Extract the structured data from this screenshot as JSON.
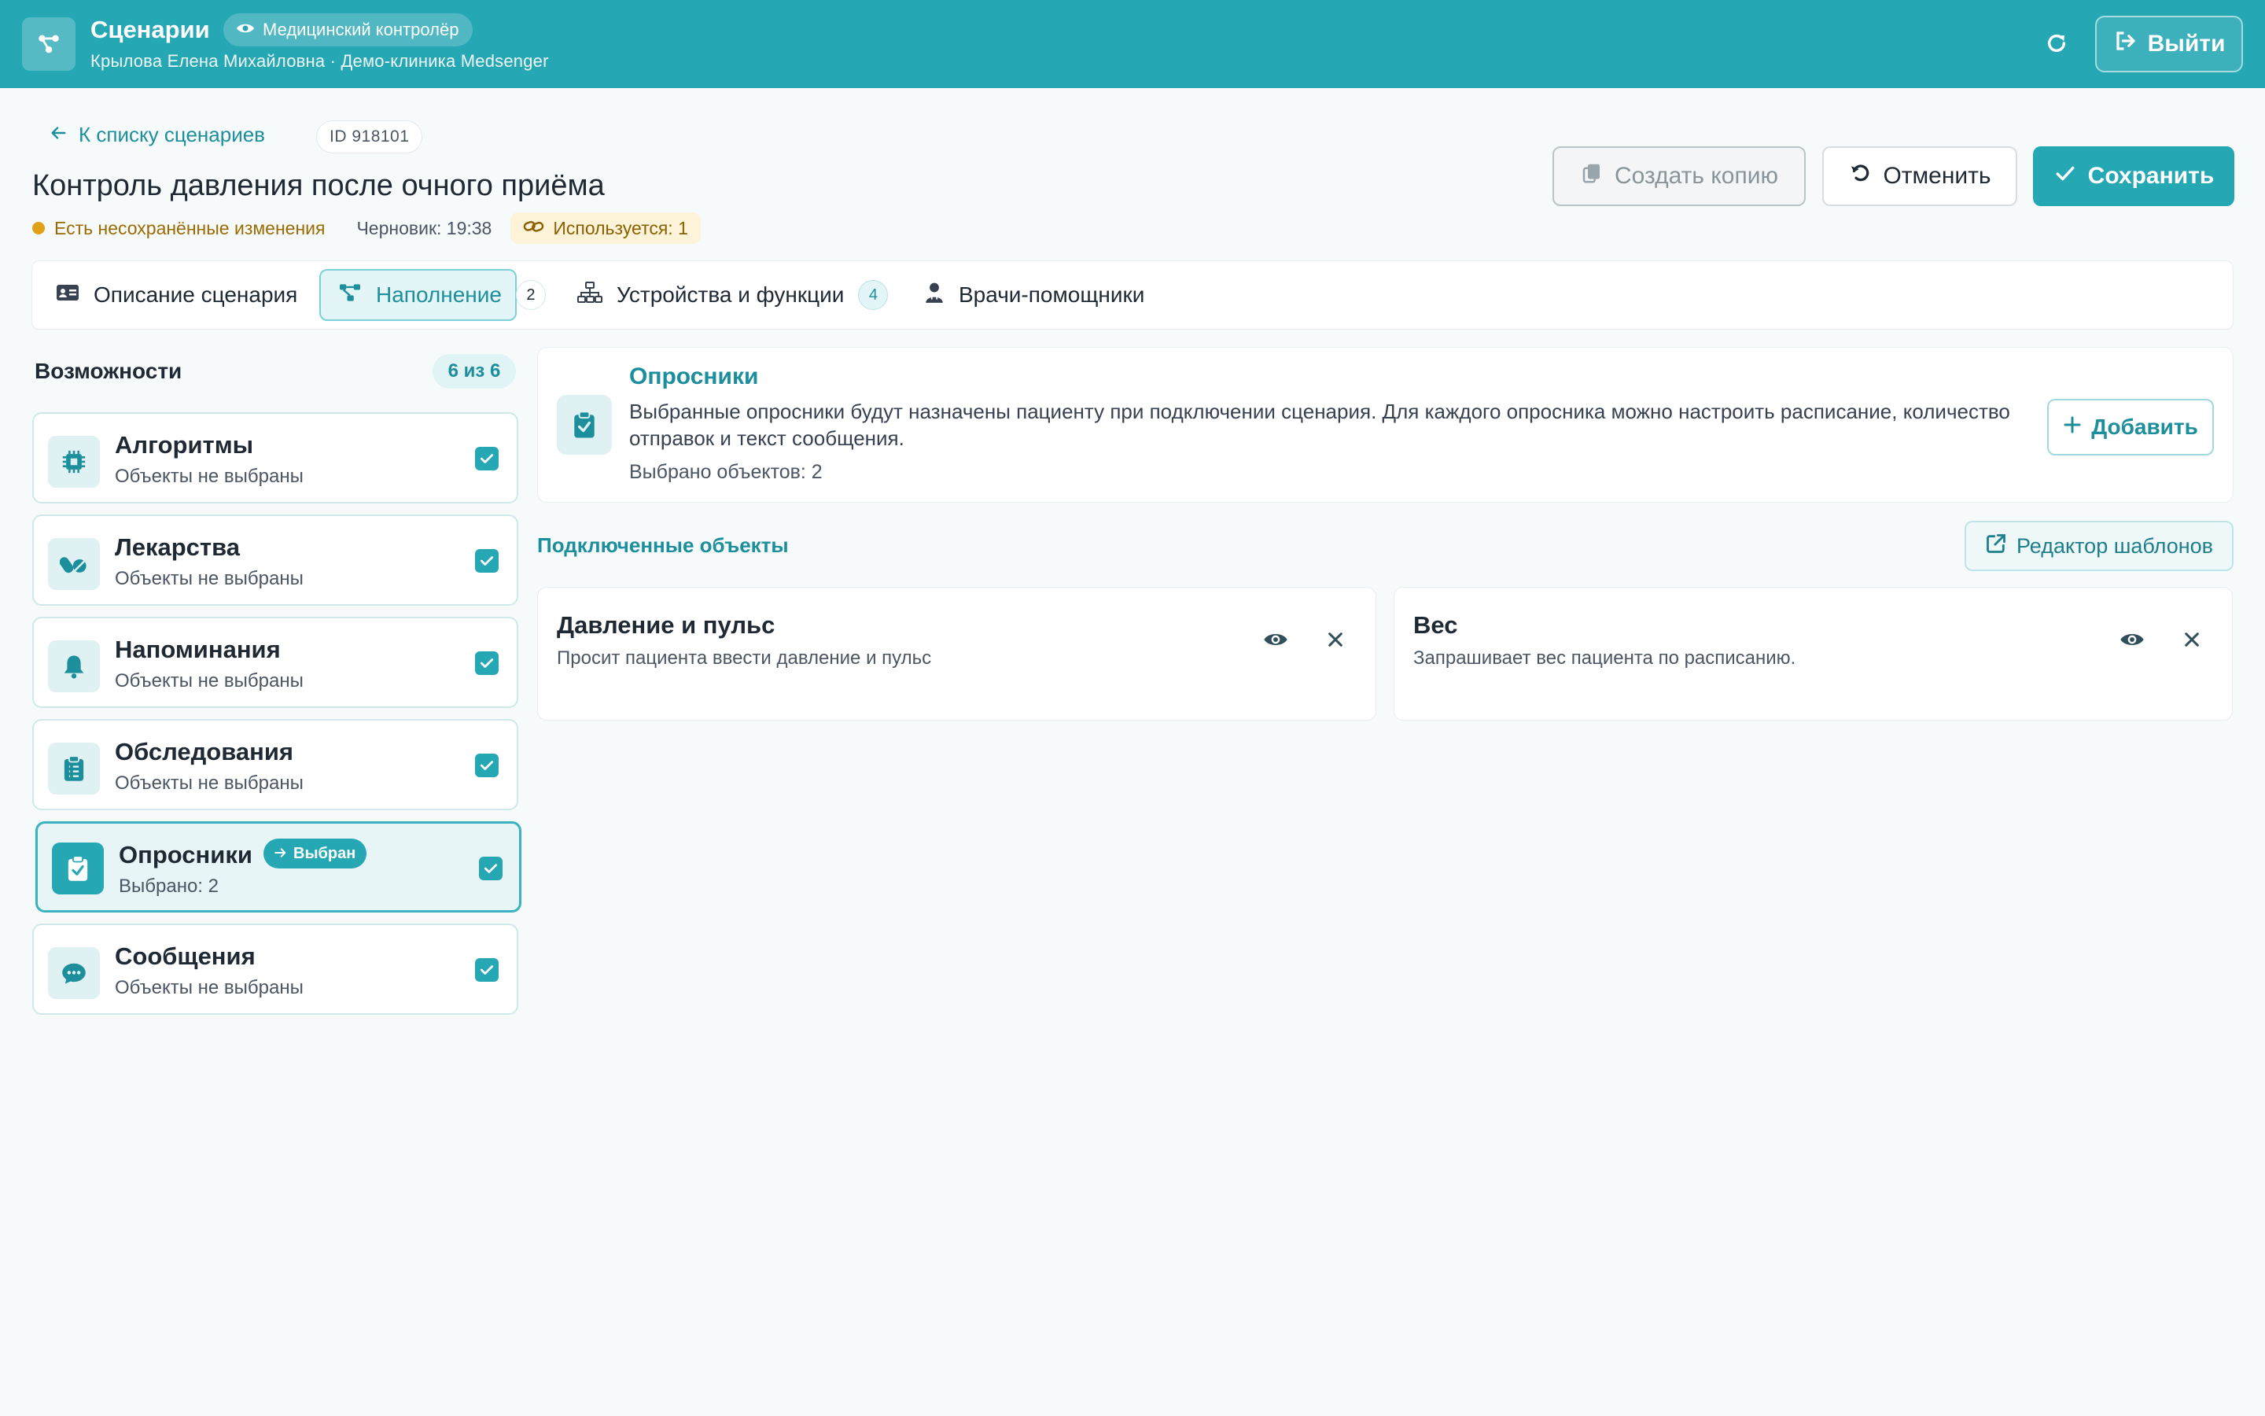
{
  "header": {
    "app_title": "Сценарии",
    "role_badge": "Медицинский контролёр",
    "user_line": "Крылова Елена Михайловна · Демо-клиника Medsenger",
    "logout_label": "Выйти",
    "icons": {
      "logo": "share-nodes-icon",
      "role": "eye-icon",
      "refresh": "refresh-icon",
      "logout": "logout-icon"
    }
  },
  "breadcrumb": {
    "back_label": "К списку сценариев",
    "id_chip": "ID 918101"
  },
  "page": {
    "title": "Контроль давления после очного приёма",
    "unsaved_label": "Есть несохранённые изменения",
    "draft_label": "Черновик: 19:38",
    "used_label": "Используется: 1"
  },
  "actions": {
    "copy_label": "Создать копию",
    "cancel_label": "Отменить",
    "save_label": "Сохранить"
  },
  "tabs": [
    {
      "label": "Описание сценария",
      "icon": "id-card-icon"
    },
    {
      "label": "Наполнение",
      "count": "2",
      "icon": "share-nodes-icon",
      "active": true
    },
    {
      "label": "Устройства и функции",
      "count": "4",
      "icon": "sitemap-icon"
    },
    {
      "label": "Врачи-помощники",
      "icon": "doctor-icon"
    }
  ],
  "capabilities": {
    "title": "Возможности",
    "count": "6 из 6",
    "items": [
      {
        "name": "Алгоритмы",
        "sub": "Объекты не выбраны",
        "icon": "chip-icon"
      },
      {
        "name": "Лекарства",
        "sub": "Объекты не выбраны",
        "icon": "pills-icon"
      },
      {
        "name": "Напоминания",
        "sub": "Объекты не выбраны",
        "icon": "bell-icon"
      },
      {
        "name": "Обследования",
        "sub": "Объекты не выбраны",
        "icon": "clipboard-list-icon"
      },
      {
        "name": "Опросники",
        "sub": "Выбрано: 2",
        "icon": "clipboard-check-icon",
        "badge": "Выбран",
        "selected": true
      },
      {
        "name": "Сообщения",
        "sub": "Объекты не выбраны",
        "icon": "chat-icon"
      }
    ]
  },
  "panel": {
    "title": "Опросники",
    "description": "Выбранные опросники будут назначены пациенту при подключении сценария. Для каждого опросника можно настроить расписание, количество отправок и текст сообщения.",
    "count_label": "Выбрано объектов: 2",
    "add_label": "Добавить"
  },
  "connected": {
    "title": "Подключенные объекты",
    "template_editor_label": "Редактор шаблонов",
    "items": [
      {
        "title": "Давление и пульс",
        "desc": "Просит пациента ввести давление и пульс"
      },
      {
        "title": "Вес",
        "desc": "Запрашивает вес пациента по расписанию."
      }
    ]
  },
  "colors": {
    "brand": "#26a7b4",
    "brand_dark": "#1d8f9c",
    "warning": "#e0a018",
    "background": "#f7fafb"
  }
}
